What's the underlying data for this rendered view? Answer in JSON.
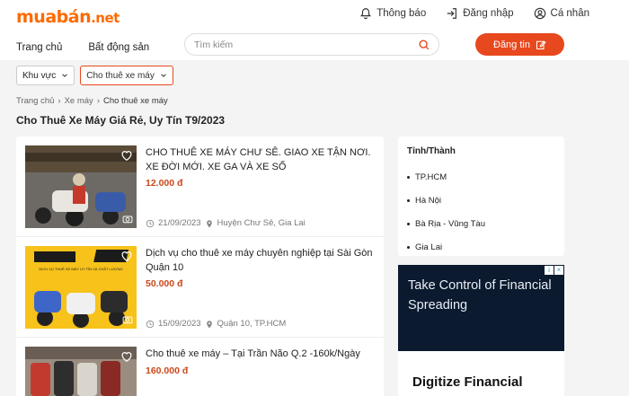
{
  "header": {
    "logo_brand": "muabán",
    "logo_tld": ".net",
    "top_links": [
      "Thông báo",
      "Đăng nhập",
      "Cá nhân"
    ],
    "nav": [
      "Trang chủ",
      "Bất động sản"
    ],
    "search_placeholder": "Tìm kiếm",
    "post_button": "Đăng tin"
  },
  "filters": {
    "area": "Khu vực",
    "category": "Cho thuê xe máy"
  },
  "breadcrumb": [
    "Trang chủ",
    "Xe máy",
    "Cho thuê xe máy"
  ],
  "page_title": "Cho Thuê Xe Máy Giá Rẻ, Uy Tín T9/2023",
  "listings": [
    {
      "title": "CHO THUÊ XE MÁY CHƯ SÊ. GIAO XE TẬN NƠI. XE ĐỜI MỚI. XE GA VÀ XE SỐ",
      "price": "12.000 đ",
      "date": "21/09/2023",
      "location": "Huyện Chư Sê, Gia Lai"
    },
    {
      "title": "Dịch vụ cho thuê xe máy chuyên nghiệp tại Sài Gòn Quận 10",
      "price": "50.000 đ",
      "date": "15/09/2023",
      "location": "Quận 10, TP.HCM",
      "thumb_text": "DỊCH VỤ THUÊ XE MÁY UY TÍN VÀ CHẤT LƯỢNG"
    },
    {
      "title": "Cho thuê xe máy – Tại Trần Não Q.2 -160k/Ngày",
      "price": "160.000 đ",
      "date": "",
      "location": ""
    }
  ],
  "sidebar": {
    "heading": "Tỉnh/Thành",
    "items": [
      "TP.HCM",
      "Hà Nội",
      "Bà Rịa - Vũng Tàu",
      "Gia Lai"
    ]
  },
  "ad": {
    "headline": "Take Control of Financial Spreading",
    "sub": "Digitize Financial"
  },
  "colors": {
    "brand": "#ff6a00",
    "button": "#e8481e",
    "price": "#c9481c"
  }
}
